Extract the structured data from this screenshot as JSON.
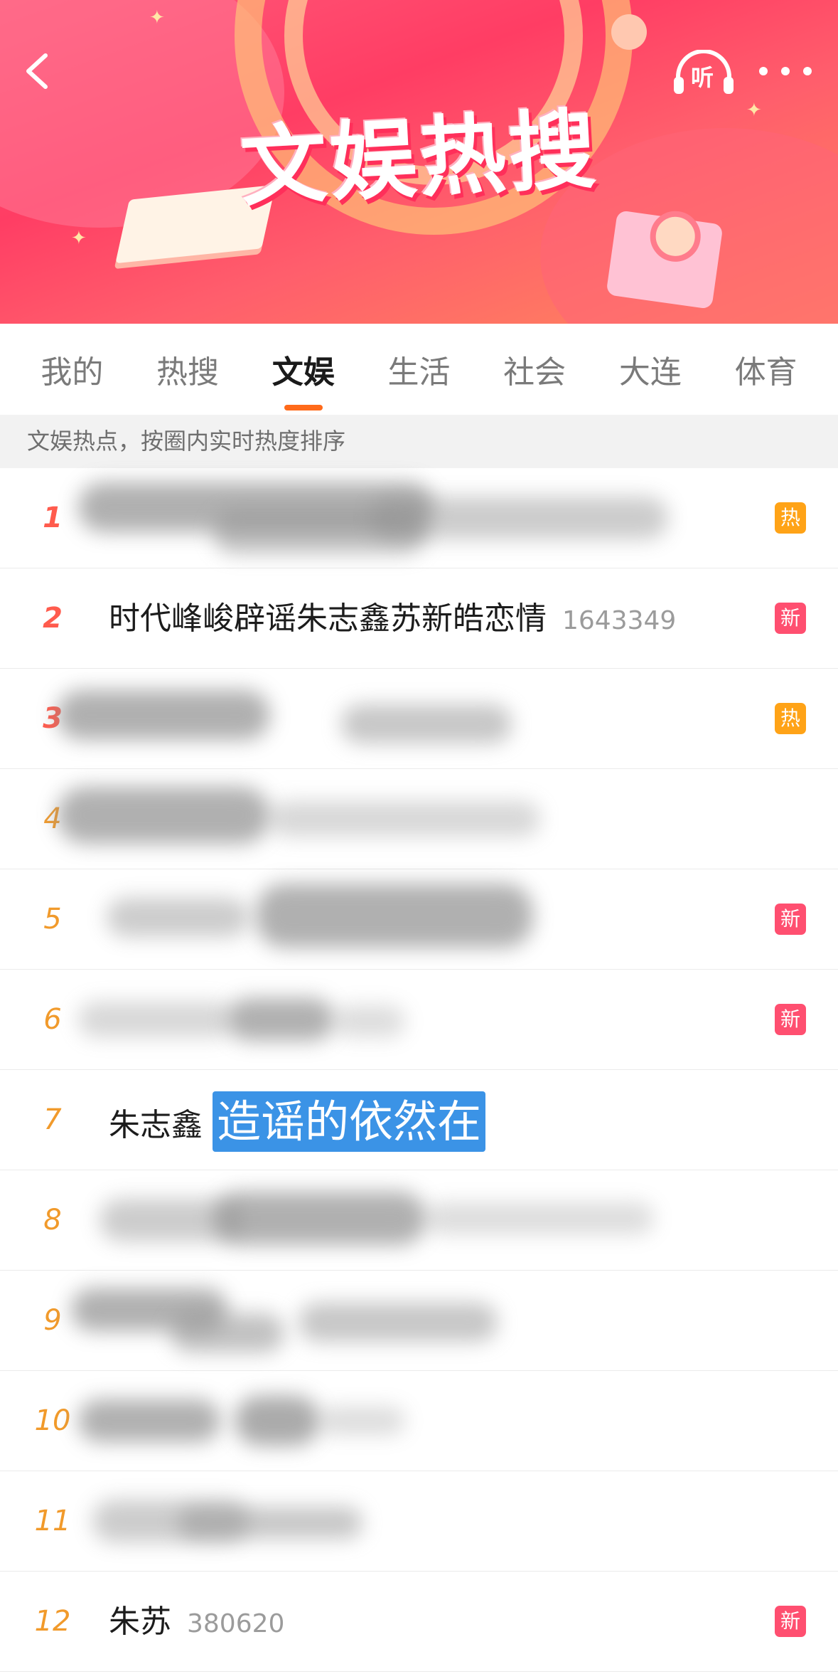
{
  "header": {
    "title": "文娱热搜",
    "listen_label": "听"
  },
  "tabs": [
    {
      "label": "我的"
    },
    {
      "label": "热搜"
    },
    {
      "label": "文娱",
      "active": true
    },
    {
      "label": "生活"
    },
    {
      "label": "社会"
    },
    {
      "label": "大连"
    },
    {
      "label": "体育"
    }
  ],
  "notice": "文娱热点，按圈内实时热度排序",
  "list": [
    {
      "rank": "1",
      "title": "",
      "count": "",
      "badge": "热",
      "blurred": true
    },
    {
      "rank": "2",
      "title": "时代峰峻辟谣朱志鑫苏新皓恋情",
      "count": "1643349",
      "badge": "新"
    },
    {
      "rank": "3",
      "title": "",
      "count": "",
      "badge": "热",
      "blurred": true
    },
    {
      "rank": "4",
      "title": "",
      "count": "",
      "badge": "",
      "blurred": true
    },
    {
      "rank": "5",
      "title": "",
      "count": "",
      "badge": "新",
      "blurred": true
    },
    {
      "rank": "6",
      "title": "",
      "count": "",
      "badge": "新",
      "blurred": true
    },
    {
      "rank": "7",
      "title": "朱志鑫",
      "count": "",
      "badge": "",
      "overlay": "造谣的依然在"
    },
    {
      "rank": "8",
      "title": "",
      "count": "",
      "badge": "",
      "blurred": true
    },
    {
      "rank": "9",
      "title": "",
      "count": "",
      "badge": "",
      "blurred": true
    },
    {
      "rank": "10",
      "title": "",
      "count": "",
      "badge": "",
      "blurred": true
    },
    {
      "rank": "11",
      "title": "",
      "count": "",
      "badge": "",
      "blurred": true
    },
    {
      "rank": "12",
      "title": "朱苏",
      "count": "380620",
      "badge": "新"
    }
  ],
  "colors": {
    "accent": "#ff6a1a",
    "hot_badge": "#ffa317",
    "new_badge": "#ff4f70",
    "rank_top": "#ff5b4d",
    "rank_other": "#f19a2b",
    "overlay_highlight": "#3b93e6"
  },
  "icons": {
    "back": "chevron-left-icon",
    "listen": "headphones-icon",
    "more": "more-dots-icon"
  }
}
